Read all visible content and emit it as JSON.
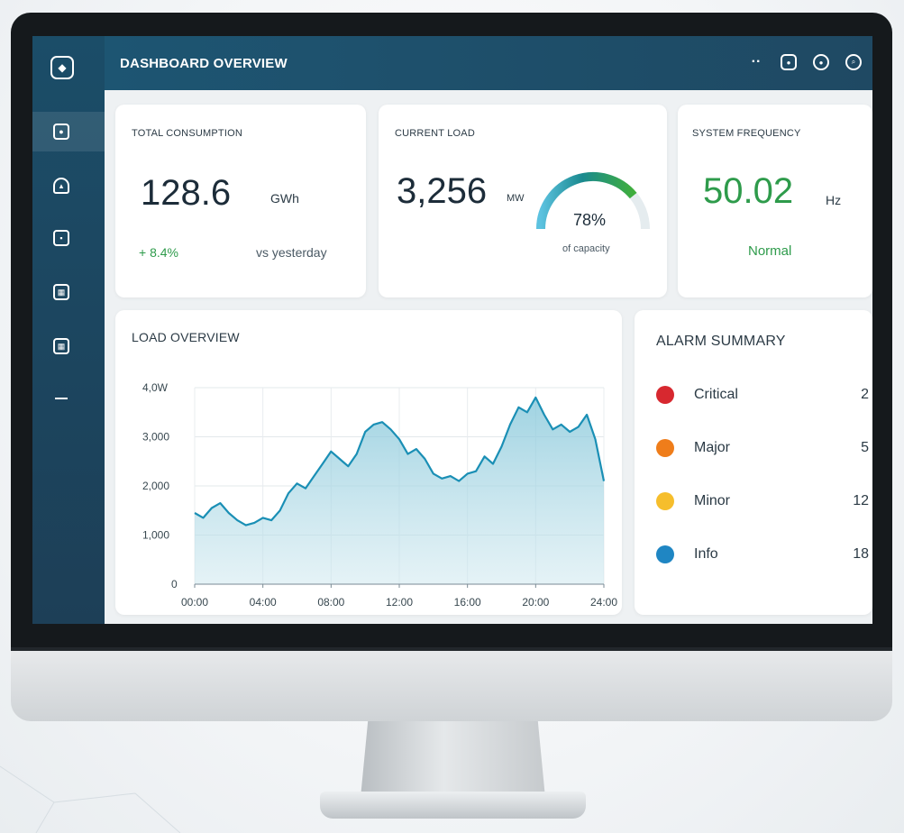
{
  "header": {
    "title": "DASHBOARD OVERVIEW",
    "icons": [
      "more-icon",
      "camera-icon",
      "clock-icon",
      "search-icon"
    ]
  },
  "sidebar": {
    "items": [
      {
        "icon": "home-icon"
      },
      {
        "icon": "gauge-icon"
      },
      {
        "icon": "device-icon"
      },
      {
        "icon": "building-icon"
      },
      {
        "icon": "grid-icon"
      },
      {
        "icon": "minus-icon"
      }
    ]
  },
  "kpis": {
    "consumption": {
      "label": "TOTAL CONSUMPTION",
      "value": "128.6",
      "unit": "GWh",
      "change": "+ 8.4%",
      "change_note": "vs yesterday",
      "change_color": "#2e9b4b"
    },
    "load": {
      "label": "CURRENT LOAD",
      "value": "3,256",
      "unit": "MW",
      "gauge_percent_text": "78%",
      "gauge_fraction": 0.78,
      "gauge_caption": "of capacity"
    },
    "frequency": {
      "label": "SYSTEM FREQUENCY",
      "value": "50.02",
      "unit": "Hz",
      "status": "Normal",
      "value_color": "#2e9b4b"
    }
  },
  "alarms": {
    "title": "ALARM SUMMARY",
    "items": [
      {
        "name": "Critical",
        "count": "2",
        "color": "#d7282f"
      },
      {
        "name": "Major",
        "count": "5",
        "color": "#ef7d1a"
      },
      {
        "name": "Minor",
        "count": "12",
        "color": "#f6be2c"
      },
      {
        "name": "Info",
        "count": "18",
        "color": "#1f86c3"
      }
    ]
  },
  "chart_data": {
    "type": "area",
    "title": "LOAD OVERVIEW",
    "xlabel": "",
    "ylabel": "",
    "x_ticks": [
      "00:00",
      "04:00",
      "08:00",
      "12:00",
      "16:00",
      "20:00",
      "24:00"
    ],
    "y_ticks": [
      "0",
      "1,000",
      "2,000",
      "3,000",
      "4,0W"
    ],
    "ylim": [
      0,
      4000
    ],
    "xlim": [
      0,
      24
    ],
    "grid": true,
    "series": [
      {
        "color": "#1a8fb5",
        "x": [
          0,
          0.5,
          1,
          1.5,
          2,
          2.5,
          3,
          3.5,
          4,
          4.5,
          5,
          5.5,
          6,
          6.5,
          7,
          7.5,
          8,
          8.5,
          9,
          9.5,
          10,
          10.5,
          11,
          11.5,
          12,
          12.5,
          13,
          13.5,
          14,
          14.5,
          15,
          15.5,
          16,
          16.5,
          17,
          17.5,
          18,
          18.5,
          19,
          19.5,
          20,
          20.5,
          21,
          21.5,
          22,
          22.5,
          23,
          23.5,
          24
        ],
        "y": [
          1450,
          1350,
          1550,
          1650,
          1450,
          1300,
          1200,
          1250,
          1350,
          1300,
          1500,
          1850,
          2050,
          1950,
          2200,
          2450,
          2700,
          2550,
          2400,
          2650,
          3100,
          3250,
          3300,
          3150,
          2950,
          2650,
          2750,
          2550,
          2250,
          2150,
          2200,
          2100,
          2250,
          2300,
          2600,
          2450,
          2800,
          3250,
          3600,
          3500,
          3800,
          3450,
          3150,
          3250,
          3100,
          3200,
          3450,
          2950,
          2100
        ]
      }
    ]
  }
}
